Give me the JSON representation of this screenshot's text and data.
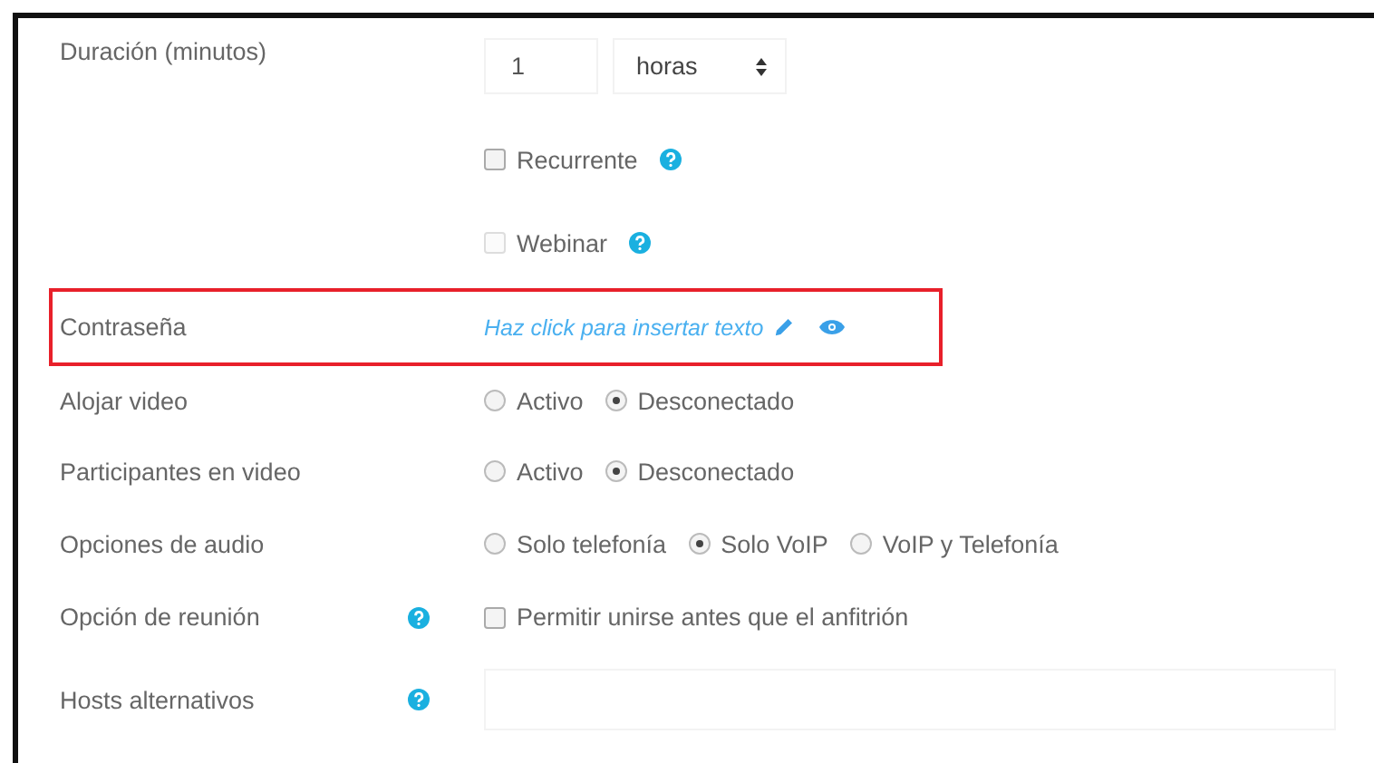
{
  "rows": [
    {
      "kind": "duration",
      "label": "Duración (minutos)",
      "value": "1",
      "unit": "horas",
      "highlighted": false
    },
    {
      "kind": "check",
      "options": [
        {
          "label": "Recurrente",
          "checked": false,
          "disabled": false,
          "help": true
        }
      ],
      "highlighted": false
    },
    {
      "kind": "check",
      "options": [
        {
          "label": "Webinar",
          "checked": false,
          "disabled": true,
          "help": true
        }
      ],
      "highlighted": false
    },
    {
      "kind": "password",
      "label": "Contraseña",
      "placeholder": "Haz click para insertar texto",
      "highlighted": true
    },
    {
      "kind": "radio",
      "label": "Alojar video",
      "options": [
        {
          "label": "Activo",
          "selected": false
        },
        {
          "label": "Desconectado",
          "selected": true
        }
      ],
      "highlighted": false
    },
    {
      "kind": "radio",
      "label": "Participantes en video",
      "options": [
        {
          "label": "Activo",
          "selected": false
        },
        {
          "label": "Desconectado",
          "selected": true
        }
      ],
      "highlighted": false
    },
    {
      "kind": "radio",
      "label": "Opciones de audio",
      "options": [
        {
          "label": "Solo telefonía",
          "selected": false
        },
        {
          "label": "Solo VoIP",
          "selected": true
        },
        {
          "label": "VoIP y Telefonía",
          "selected": false
        }
      ],
      "highlighted": false
    },
    {
      "kind": "check",
      "label": "Opción de reunión",
      "help": true,
      "options": [
        {
          "label": "Permitir unirse antes que el anfitrión",
          "checked": false,
          "disabled": false
        }
      ],
      "highlighted": false
    },
    {
      "kind": "text",
      "label": "Hosts alternativos",
      "help": true,
      "highlighted": false
    }
  ]
}
